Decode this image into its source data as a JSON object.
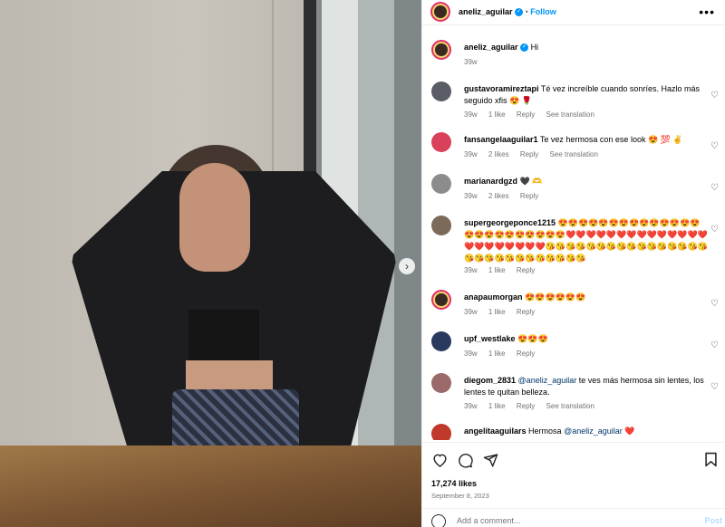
{
  "post": {
    "author": "aneliz_aguilar",
    "follow_label": "Follow",
    "more_icon": "more-horizontal-icon",
    "caption": {
      "user": "aneliz_aguilar",
      "text": "Hi",
      "time": "39w"
    }
  },
  "comments": [
    {
      "user": "gustavoramireztapi",
      "text": "Té vez increíble cuando sonríes. Hazlo más seguido xfis 😍 🌹",
      "time": "39w",
      "likes": "1 like",
      "reply": "Reply",
      "translate": "See translation"
    },
    {
      "user": "fansangelaaguilar1",
      "text": "Te vez hermosa con ese look 😍 💯 ✌️",
      "time": "39w",
      "likes": "2 likes",
      "reply": "Reply",
      "translate": "See translation"
    },
    {
      "user": "marianardgzd",
      "text": "🖤 🫶",
      "time": "39w",
      "likes": "2 likes",
      "reply": "Reply",
      "translate": ""
    },
    {
      "user": "supergeorgeponce1215",
      "text": "😍😍😍😍😍😍😍😍😍😍😍😍😍😍😍😍😍😍😍😍😍😍😍😍❤️❤️❤️❤️❤️❤️❤️❤️❤️❤️❤️❤️❤️❤️❤️❤️❤️❤️❤️❤️❤️❤️😘😘😘😘😘😘😘😘😘😘😘😘😘😘😘😘😘😘😘😘😘😘😘😘😘😘😘😘",
      "time": "39w",
      "likes": "1 like",
      "reply": "Reply",
      "translate": ""
    },
    {
      "user": "anapaumorgan",
      "text": "😍😍😍😍😍😍",
      "time": "39w",
      "likes": "1 like",
      "reply": "Reply",
      "translate": ""
    },
    {
      "user": "upf_westlake",
      "text": "😍😍😍",
      "time": "39w",
      "likes": "1 like",
      "reply": "Reply",
      "translate": ""
    },
    {
      "user": "diegom_2831",
      "mention": "@aneliz_aguilar",
      "text": "te ves más hermosa sin lentes, los lentes te quitan belleza.",
      "time": "39w",
      "likes": "1 like",
      "reply": "Reply",
      "translate": "See translation"
    },
    {
      "user": "angelitaaguilars",
      "text": "Hermosa",
      "mention": "@aneliz_aguilar",
      "suffix": "❤️",
      "time": "",
      "likes": "",
      "reply": "",
      "translate": ""
    }
  ],
  "footer": {
    "likes": "17,274 likes",
    "date": "September 8, 2023",
    "add_comment_placeholder": "Add a comment...",
    "post_label": "Post"
  },
  "colors": {
    "link": "#0095f6",
    "meta": "#737373",
    "like_heart": "#ed4956"
  }
}
